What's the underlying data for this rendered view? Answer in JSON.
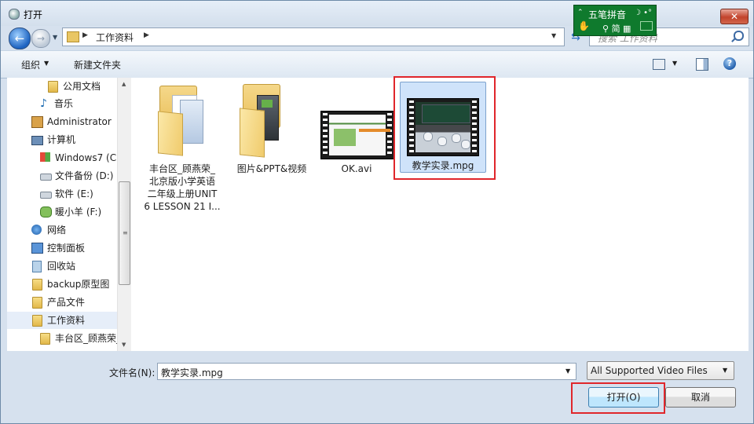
{
  "window": {
    "title": "打开",
    "close_glyph": "✕"
  },
  "address": {
    "breadcrumb": "工作资料",
    "refresh_glyph": "⇆"
  },
  "search": {
    "placeholder": "搜索 工作资料"
  },
  "ime": {
    "name": "五笔拼音",
    "mode": "简"
  },
  "toolbar": {
    "organize_label": "组织",
    "new_folder_label": "新建文件夹",
    "help_glyph": "?"
  },
  "sidebar": {
    "items": [
      {
        "label": "公用文档",
        "icon": "folder-icon"
      },
      {
        "label": "音乐",
        "icon": "music-icon"
      },
      {
        "label": "Administrator",
        "icon": "user-folder-icon"
      },
      {
        "label": "计算机",
        "icon": "computer-icon"
      },
      {
        "label": "Windows7 (C:",
        "icon": "windows-drive-icon"
      },
      {
        "label": "文件备份 (D:)",
        "icon": "drive-icon"
      },
      {
        "label": "软件 (E:)",
        "icon": "drive-icon"
      },
      {
        "label": "暖小羊 (F:)",
        "icon": "usb-drive-icon"
      },
      {
        "label": "网络",
        "icon": "network-icon"
      },
      {
        "label": "控制面板",
        "icon": "control-panel-icon"
      },
      {
        "label": "回收站",
        "icon": "recycle-bin-icon"
      },
      {
        "label": "backup原型图",
        "icon": "folder-icon"
      },
      {
        "label": "产品文件",
        "icon": "folder-icon"
      },
      {
        "label": "工作资料",
        "icon": "folder-icon",
        "selected": true
      },
      {
        "label": "丰台区_顾燕荣_",
        "icon": "folder-icon"
      }
    ]
  },
  "files": [
    {
      "name_lines": [
        "丰台区_顾燕荣_",
        "北京版小学英语",
        "二年级上册UNIT",
        "6 LESSON 21 I..."
      ],
      "type": "folder"
    },
    {
      "name_lines": [
        "图片&PPT&视频"
      ],
      "type": "folder"
    },
    {
      "name_lines": [
        "OK.avi"
      ],
      "type": "video"
    },
    {
      "name_lines": [
        "教学实录.mpg"
      ],
      "type": "video",
      "selected": true
    }
  ],
  "bottom": {
    "filename_label": "文件名(N):",
    "filename_value": "教学实录.mpg",
    "filetype_value": "All Supported Video Files",
    "open_label": "打开(O)",
    "cancel_label": "取消"
  },
  "colors": {
    "highlight": "#e0262b",
    "selection": "#cfe3fa"
  }
}
